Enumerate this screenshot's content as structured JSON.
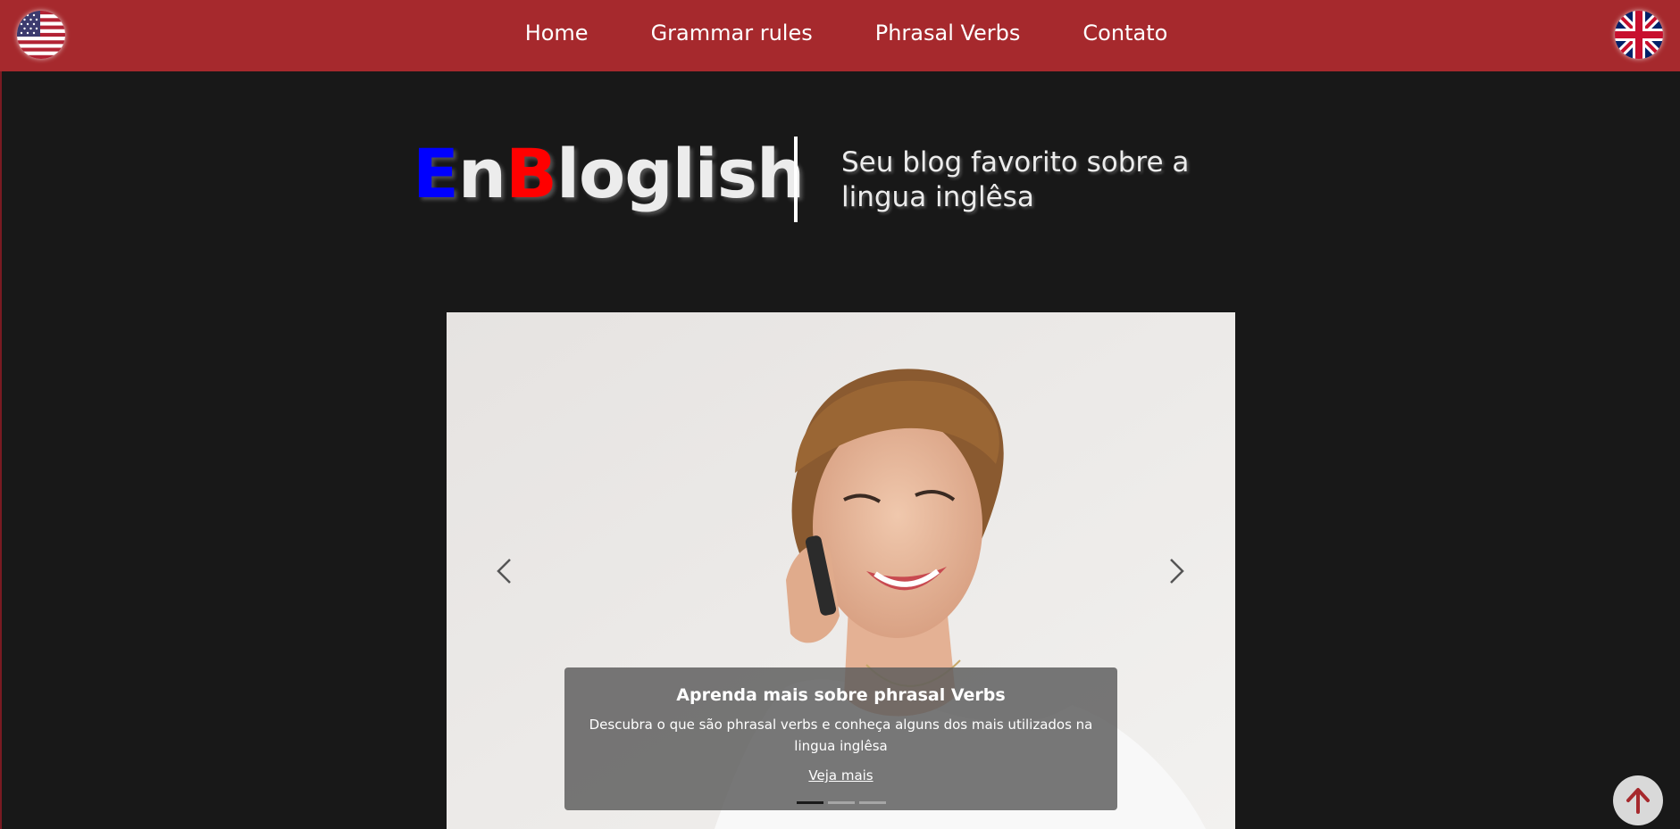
{
  "nav": {
    "items": [
      "Home",
      "Grammar rules",
      "Phrasal Verbs",
      "Contato"
    ],
    "left_flag": "us-flag-icon",
    "right_flag": "uk-flag-icon",
    "background": "#a6292d"
  },
  "header": {
    "brand": {
      "e": "E",
      "n": "n",
      "b": "B",
      "rest": "loglish"
    },
    "tagline": "Seu blog favorito sobre a lingua inglêsa"
  },
  "carousel": {
    "slide": {
      "title": "Aprenda mais sobre phrasal Verbs",
      "text": "Descubra o que são phrasal verbs e conheça alguns dos mais utilizados na lingua inglêsa",
      "link": "Veja mais"
    },
    "indicators": 3,
    "active_index": 0,
    "prev_icon": "chevron-left-icon",
    "next_icon": "chevron-right-icon"
  },
  "back_to_top": {
    "icon": "arrow-up-icon",
    "color": "#a6292d"
  },
  "colors": {
    "background": "#181818",
    "brand_blue": "#0000ff",
    "brand_red": "#ff0000"
  }
}
